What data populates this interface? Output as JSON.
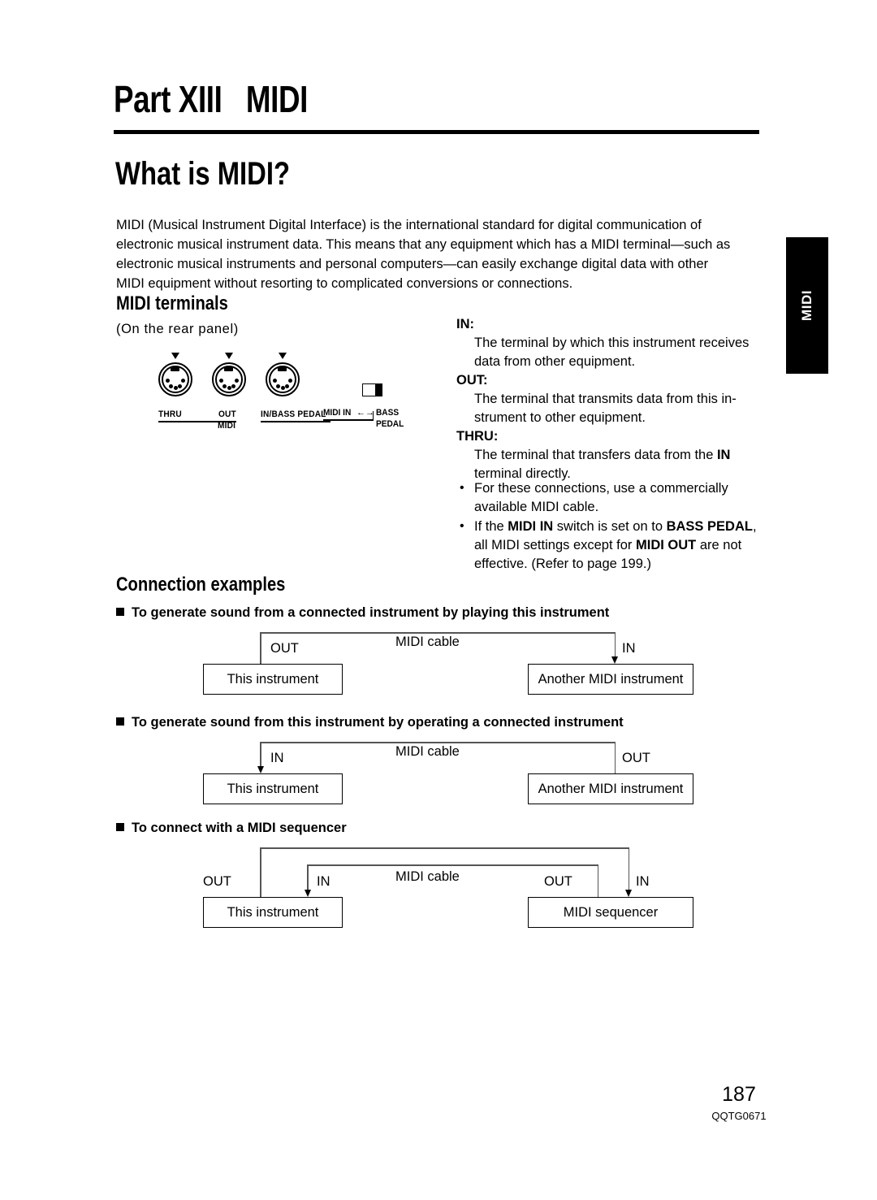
{
  "part_title": "Part XIII   MIDI",
  "headings": {
    "what_is_midi": "What is MIDI?",
    "midi_terminals": "MIDI terminals",
    "connection_examples": "Connection examples"
  },
  "intro_lines": [
    "MIDI (Musical Instrument Digital Interface) is the international standard for digital communication of",
    "electronic musical instrument data. This means that any equipment which has a MIDI terminal—such as",
    "electronic musical instruments and personal computers—can easily exchange digital data with other",
    "MIDI equipment without resorting to complicated conversions or connections."
  ],
  "rear_panel_note": "(On the rear panel)",
  "connector_diagram": {
    "connectors": [
      {
        "label": "THRU"
      },
      {
        "label": "OUT"
      },
      {
        "label": "IN/BASS PEDAL"
      }
    ],
    "group_label": "MIDI",
    "switch": {
      "left_label": "MIDI IN",
      "arrow": "←→",
      "right_label_line1": "BASS",
      "right_label_line2": "PEDAL"
    }
  },
  "terminals": [
    {
      "name": "IN:",
      "desc_lines": [
        "The terminal by which this instrument receives",
        "data from other equipment."
      ]
    },
    {
      "name": "OUT:",
      "desc_lines": [
        "The terminal that transmits data from this in-",
        "strument to other equipment."
      ]
    },
    {
      "name": "THRU:",
      "desc_lines": [
        "The terminal that transfers data from the IN",
        "terminal directly."
      ]
    }
  ],
  "notes": [
    {
      "bullet": "•",
      "lines": [
        "For these connections, use a commercially",
        "available MIDI cable."
      ]
    },
    {
      "bullet": "•",
      "lines": [
        "If the MIDI IN switch is set on to BASS PEDAL,",
        "all MIDI settings except for MIDI OUT are not",
        "effective. (Refer to page 199.)"
      ]
    }
  ],
  "side_tab": {
    "label": "MIDI"
  },
  "examples": [
    {
      "heading": "To generate sound from a connected instrument by playing this instrument",
      "left_box": "This instrument",
      "right_box": "Another MIDI instrument",
      "cable_label": "MIDI cable",
      "left_port": "OUT",
      "right_port": "IN"
    },
    {
      "heading": "To generate sound from this instrument by operating a connected instrument",
      "left_box": "This instrument",
      "right_box": "Another MIDI instrument",
      "cable_label": "MIDI cable",
      "left_port": "IN",
      "right_port": "OUT"
    },
    {
      "heading": "To connect with a MIDI sequencer",
      "left_box": "This instrument",
      "right_box": "MIDI sequencer",
      "cable_label": "MIDI cable",
      "left_out": "OUT",
      "left_in": "IN",
      "right_out": "OUT",
      "right_in": "IN"
    }
  ],
  "footer": {
    "page_number": "187",
    "doc_code": "QQTG0671"
  }
}
